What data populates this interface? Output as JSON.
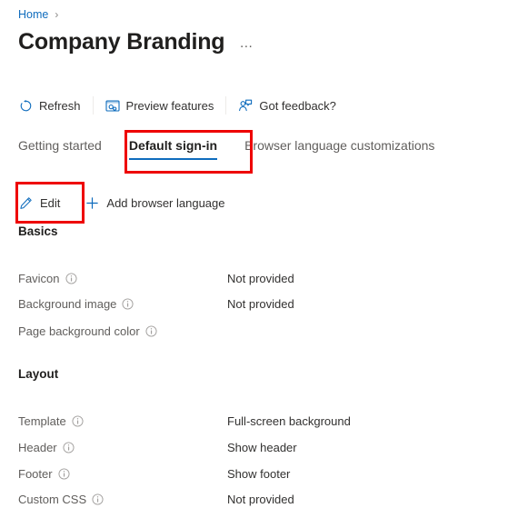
{
  "breadcrumb": {
    "home_label": "Home",
    "separator": "›"
  },
  "header": {
    "title": "Company Branding",
    "ellipsis": "…"
  },
  "commandbar": {
    "items": [
      {
        "label": "Refresh",
        "icon": "refresh-icon"
      },
      {
        "label": "Preview features",
        "icon": "preview-features-icon"
      },
      {
        "label": "Got feedback?",
        "icon": "feedback-icon"
      }
    ]
  },
  "tabs": [
    {
      "label": "Getting started",
      "selected": false
    },
    {
      "label": "Default sign-in",
      "selected": true
    },
    {
      "label": "Browser language customizations",
      "selected": false
    }
  ],
  "actionbar": {
    "edit_label": "Edit",
    "edit_icon": "pencil-icon",
    "add_language_label": "Add browser language",
    "add_language_icon": "plus-icon"
  },
  "sections": {
    "basics": {
      "title": "Basics",
      "rows": [
        {
          "label": "Favicon",
          "value": "Not provided"
        },
        {
          "label": "Background image",
          "value": "Not provided"
        },
        {
          "label": "Page background color",
          "value": ""
        }
      ]
    },
    "layout": {
      "title": "Layout",
      "rows": [
        {
          "label": "Template",
          "value": "Full-screen background"
        },
        {
          "label": "Header",
          "value": "Show header"
        },
        {
          "label": "Footer",
          "value": "Show footer"
        },
        {
          "label": "Custom CSS",
          "value": "Not provided"
        }
      ]
    }
  },
  "colors": {
    "accent_blue": "#0f6cbd",
    "annotation_red": "#ee0000",
    "label_gray": "#605e5c",
    "text_dark": "#201f1e"
  }
}
